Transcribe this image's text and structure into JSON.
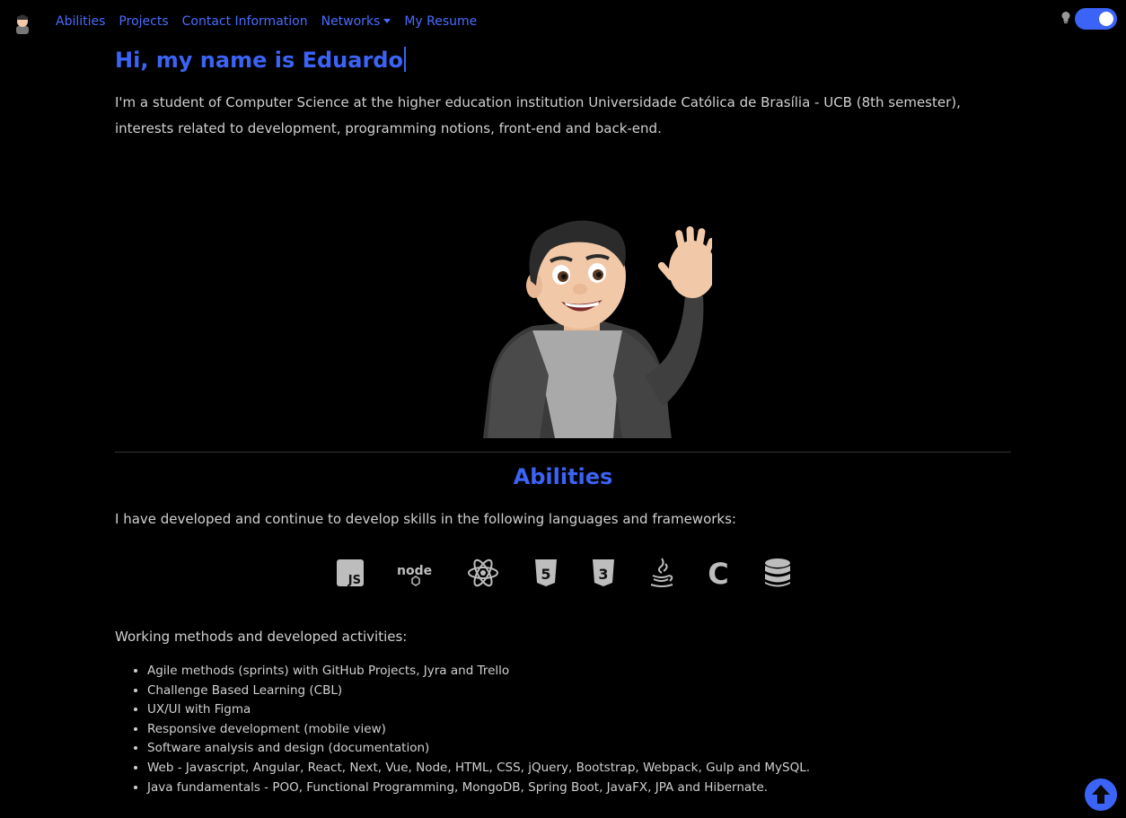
{
  "nav": {
    "links": [
      "Abilities",
      "Projects",
      "Contact Information",
      "Networks",
      "My Resume"
    ],
    "dropdown_label": "Networks",
    "theme_toggle_on": true
  },
  "hero": {
    "title": "Hi, my name is Eduardo",
    "intro": "I'm a student of Computer Science at the higher education institution Universidade Católica de Brasília - UCB (8th semester), interests related to development, programming notions, front-end and back-end."
  },
  "abilities": {
    "title": "Abilities",
    "text": "I have developed and continue to develop skills in the following languages and frameworks:",
    "icons": [
      "javascript-icon",
      "nodejs-icon",
      "react-icon",
      "html5-icon",
      "css3-icon",
      "java-icon",
      "c-language-icon",
      "database-icon"
    ],
    "icon_labels": {
      "javascript": "JS",
      "node": "node",
      "css": "3",
      "html": "5",
      "c": "C"
    }
  },
  "methods": {
    "title": "Working methods and developed activities:",
    "items": [
      "Agile methods (sprints) with GitHub Projects, Jyra and Trello",
      "Challenge Based Learning (CBL)",
      "UX/UI with Figma",
      "Responsive development (mobile view)",
      "Software analysis and design (documentation)",
      "Web - Javascript, Angular, React, Next, Vue, Node, HTML, CSS, jQuery, Bootstrap, Webpack, Gulp and MySQL.",
      "Java fundamentals - POO, Functional Programming, MongoDB, Spring Boot, JavaFX, JPA and Hibernate."
    ]
  },
  "colors": {
    "accent": "#3b63f5",
    "link": "#4a6cff",
    "background": "#000000",
    "text": "#d0d0d0",
    "icon_gray": "#bdbdbd"
  }
}
